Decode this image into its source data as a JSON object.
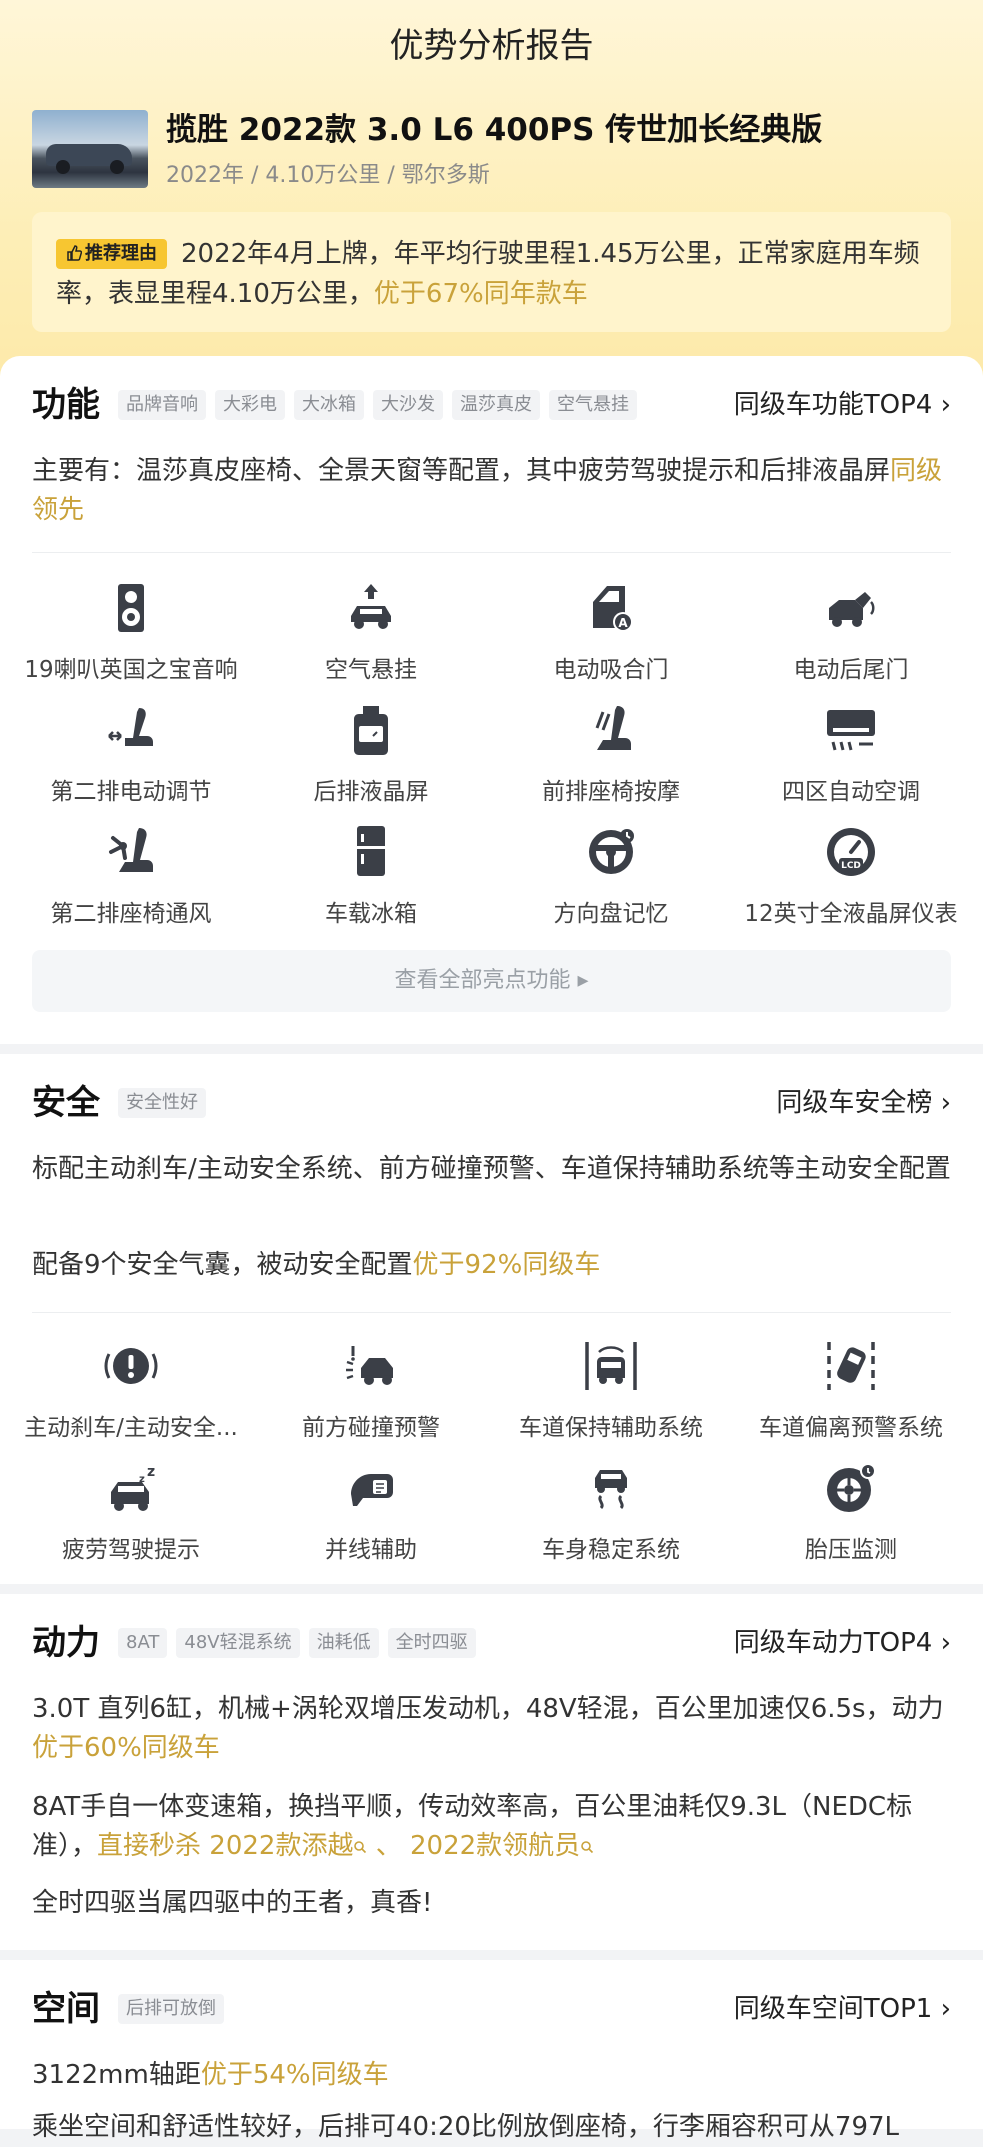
{
  "header": {
    "title": "优势分析报告",
    "car_title": "揽胜 2022款 3.0 L6 400PS 传世加长经典版",
    "car_meta": "2022年 / 4.10万公里 / 鄂尔多斯"
  },
  "reason": {
    "tag": "推荐理由",
    "text": "2022年4月上牌，年平均行驶里程1.45万公里，正常家庭用车频率，表显里程4.10万公里，",
    "highlight": "优于67%同年款车"
  },
  "function": {
    "title": "功能",
    "tags": [
      "品牌音响",
      "大彩电",
      "大冰箱",
      "大沙发",
      "温莎真皮",
      "空气悬挂"
    ],
    "link": "同级车功能TOP4 ›",
    "desc": "主要有：温莎真皮座椅、全景天窗等配置，其中疲劳驾驶提示和后排液晶屏",
    "desc_highlight": "同级领先",
    "items": [
      {
        "label": "19喇叭英国之宝音响",
        "icon": "speaker-icon"
      },
      {
        "label": "空气悬挂",
        "icon": "air-suspension-icon"
      },
      {
        "label": "电动吸合门",
        "icon": "auto-door-icon"
      },
      {
        "label": "电动后尾门",
        "icon": "power-tailgate-icon"
      },
      {
        "label": "第二排电动调节",
        "icon": "seat-adjust-icon"
      },
      {
        "label": "后排液晶屏",
        "icon": "rear-screen-icon"
      },
      {
        "label": "前排座椅按摩",
        "icon": "seat-massage-icon"
      },
      {
        "label": "四区自动空调",
        "icon": "climate-control-icon"
      },
      {
        "label": "第二排座椅通风",
        "icon": "seat-ventilation-icon"
      },
      {
        "label": "车载冰箱",
        "icon": "fridge-icon"
      },
      {
        "label": "方向盘记忆",
        "icon": "steering-memory-icon"
      },
      {
        "label": "12英寸全液晶屏仪表",
        "icon": "lcd-gauge-icon"
      }
    ],
    "show_all": "查看全部亮点功能 ▸"
  },
  "safety": {
    "title": "安全",
    "tags": [
      "安全性好"
    ],
    "link": "同级车安全榜 ›",
    "desc1": "标配主动刹车/主动安全系统、前方碰撞预警、车道保持辅助系统等主动安全配置",
    "desc2": "配备9个安全气囊，被动安全配置",
    "desc2_highlight": "优于92%同级车",
    "items": [
      {
        "label": "主动刹车/主动安全...",
        "icon": "active-brake-icon"
      },
      {
        "label": "前方碰撞预警",
        "icon": "collision-warning-icon"
      },
      {
        "label": "车道保持辅助系统",
        "icon": "lane-keep-icon"
      },
      {
        "label": "车道偏离预警系统",
        "icon": "lane-departure-icon"
      },
      {
        "label": "疲劳驾驶提示",
        "icon": "fatigue-alert-icon"
      },
      {
        "label": "并线辅助",
        "icon": "blind-spot-icon"
      },
      {
        "label": "车身稳定系统",
        "icon": "stability-control-icon"
      },
      {
        "label": "胎压监测",
        "icon": "tire-pressure-icon"
      }
    ]
  },
  "power": {
    "title": "动力",
    "tags": [
      "8AT",
      "48V轻混系统",
      "油耗低",
      "全时四驱"
    ],
    "link": "同级车动力TOP4 ›",
    "desc1": "3.0T 直列6缸，机械+涡轮双增压发动机，48V轻混，百公里加速仅6.5s，动力",
    "desc1_highlight": "优于60%同级车",
    "desc2": "8AT手自一体变速箱，换挡平顺，传动效率高，百公里油耗仅9.3L（NEDC标准），",
    "desc2_link1": "直接秒杀 2022款添越",
    "desc2_sep": " 、 ",
    "desc2_link2": "2022款领航员",
    "desc3": "全时四驱当属四驱中的王者，真香!"
  },
  "space": {
    "title": "空间",
    "tags": [
      "后排可放倒"
    ],
    "link": "同级车空间TOP1 ›",
    "desc1": "3122mm轴距",
    "desc1_highlight": "优于54%同级车",
    "desc2": "乘坐空间和舒适性较好，后排可40:20比例放倒座椅，行李厢容积可从797L"
  },
  "colors": {
    "accent": "#c9a23a",
    "tag_yellow": "#f7c631",
    "icon": "#3b3f47"
  }
}
